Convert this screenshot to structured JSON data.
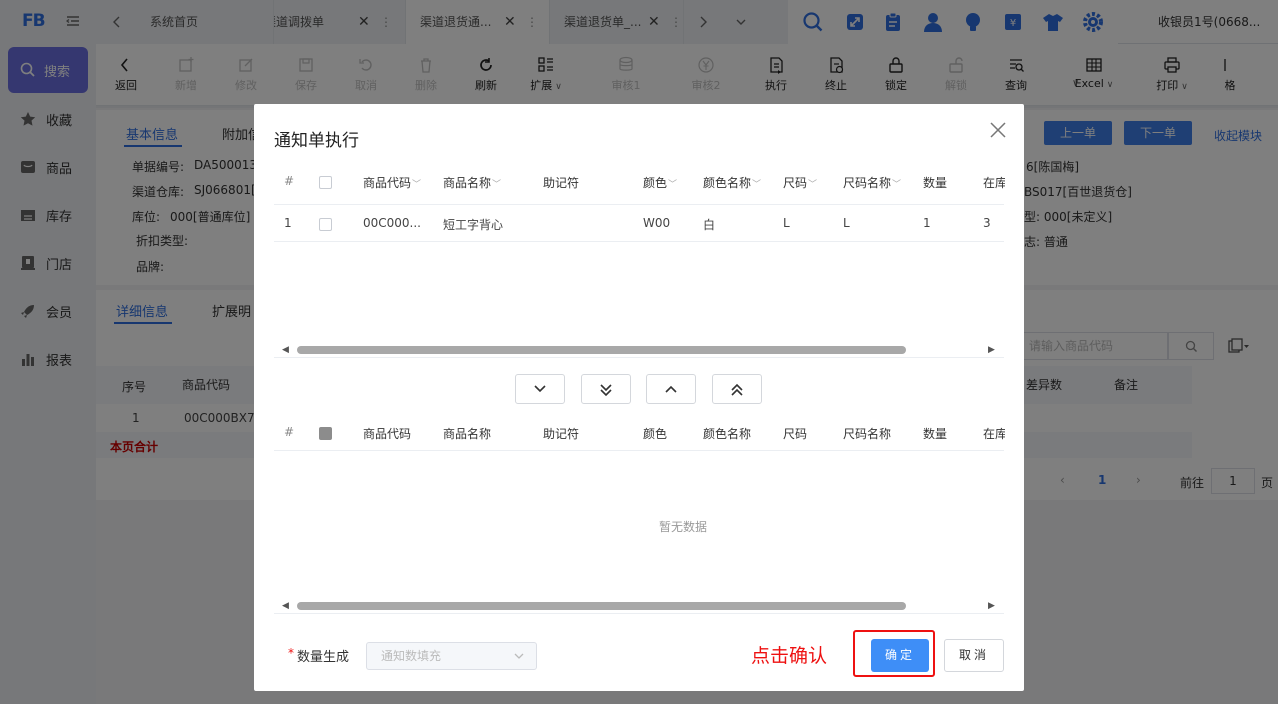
{
  "app": {
    "logo": "FB",
    "user": "收银员1号(0668..."
  },
  "tabs": [
    {
      "label": "系统首页"
    },
    {
      "label": "渠道调拨单"
    },
    {
      "label": "渠道退货通..."
    },
    {
      "label": "渠道退货单_..."
    }
  ],
  "top_icons": [
    "search-icon",
    "expand-icon",
    "clipboard-icon",
    "user-icon",
    "bulb-icon",
    "money-icon",
    "shirt-icon",
    "gear-icon"
  ],
  "sidebar": {
    "search": "搜索",
    "items": [
      {
        "label": "收藏",
        "icon": "star-icon"
      },
      {
        "label": "商品",
        "icon": "box-icon"
      },
      {
        "label": "库存",
        "icon": "warehouse-icon"
      },
      {
        "label": "门店",
        "icon": "store-icon"
      },
      {
        "label": "会员",
        "icon": "rocket-icon"
      },
      {
        "label": "报表",
        "icon": "chart-icon"
      }
    ]
  },
  "toolbar": {
    "items": [
      {
        "label": "返回",
        "icon": "back-icon",
        "enabled": true
      },
      {
        "label": "新增",
        "icon": "add-icon",
        "enabled": false
      },
      {
        "label": "修改",
        "icon": "edit-icon",
        "enabled": false
      },
      {
        "label": "保存",
        "icon": "save-icon",
        "enabled": false
      },
      {
        "label": "取消",
        "icon": "undo-icon",
        "enabled": false
      },
      {
        "label": "删除",
        "icon": "trash-icon",
        "enabled": false
      },
      {
        "label": "刷新",
        "icon": "refresh-icon",
        "enabled": true
      },
      {
        "label": "扩展",
        "icon": "grid-icon",
        "enabled": true
      },
      {
        "label": "审核1",
        "icon": "db-icon",
        "enabled": false
      },
      {
        "label": "审核2",
        "icon": "yen-icon",
        "enabled": false
      },
      {
        "label": "执行",
        "icon": "doc-run-icon",
        "enabled": true
      },
      {
        "label": "终止",
        "icon": "doc-stop-icon",
        "enabled": true
      },
      {
        "label": "锁定",
        "icon": "lock-icon",
        "enabled": true
      },
      {
        "label": "解锁",
        "icon": "unlock-icon",
        "enabled": false
      },
      {
        "label": "查询",
        "icon": "query-icon",
        "enabled": true
      },
      {
        "label": "Excel",
        "icon": "table-icon",
        "enabled": true
      },
      {
        "label": "打印",
        "icon": "print-icon",
        "enabled": true
      },
      {
        "label": "格",
        "icon": "format-icon",
        "enabled": true
      }
    ]
  },
  "info": {
    "tab_basic": "基本信息",
    "tab_extra": "附加信",
    "field_order": "单据编号:",
    "field_order_val": "DA500013",
    "field_wh": "渠道仓库:",
    "field_wh_val": "SJ066801[",
    "field_loc": "库位:",
    "field_loc_val": "000[普通库位]",
    "field_discount": "折扣类型:",
    "field_brand": "品牌:",
    "right1": "6[陈国梅]",
    "right2": "BS017[百世退货仓]",
    "right3": "型:  000[未定义]",
    "right4": "志:  普通",
    "prev_btn": "上一单",
    "next_btn": "下一单",
    "collapse": "收起模块"
  },
  "detail": {
    "tab_detail": "详细信息",
    "tab_ext": "扩展明",
    "search_placeholder": "请输入商品代码",
    "col_seq": "序号",
    "col_code": "商品代码",
    "col_diff": "差异数",
    "col_note": "备注",
    "row_seq": "1",
    "row_code": "00C000BX7...",
    "total": "本页合计",
    "page_current": "1",
    "goto_label": "前往",
    "goto_value": "1",
    "page_suffix": "页"
  },
  "dialog": {
    "title": "通知单执行",
    "columns": [
      "#",
      "",
      "商品代码",
      "商品名称",
      "助记符",
      "颜色",
      "颜色名称",
      "尺码",
      "尺码名称",
      "数量",
      "在库"
    ],
    "rows": [
      {
        "idx": "1",
        "code": "00C000...",
        "name": "短工字背心",
        "mnemonic": "",
        "color": "W00",
        "color_name": "白",
        "size": "L",
        "size_name": "L",
        "qty": "1",
        "stock": "3"
      }
    ],
    "empty_text": "暂无数据",
    "qty_label": "数量生成",
    "qty_placeholder": "通知数填充",
    "ok": "确定",
    "cancel": "取消",
    "annotation": "点击确认"
  },
  "colors": {
    "accent": "#3e8ef7",
    "annotation": "#ee1111",
    "sidebar_search": "#6b6fe0"
  }
}
